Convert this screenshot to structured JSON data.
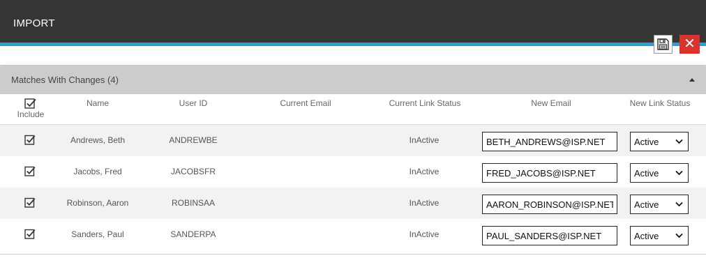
{
  "header": {
    "title": "IMPORT"
  },
  "toolbar": {
    "save_icon": "save-icon",
    "close_icon": "close-icon",
    "close_glyph": "✕"
  },
  "section": {
    "title": "Matches With Changes (4)"
  },
  "columns": {
    "include": "Include",
    "name": "Name",
    "user_id": "User ID",
    "current_email": "Current Email",
    "current_link_status": "Current Link Status",
    "new_email": "New Email",
    "new_link_status": "New Link Status"
  },
  "rows": [
    {
      "include": true,
      "name": "Andrews, Beth",
      "user_id": "ANDREWBE",
      "current_email": "",
      "current_link_status": "InActive",
      "new_email": "BETH_ANDREWS@ISP.NET",
      "new_link_status": "Active"
    },
    {
      "include": true,
      "name": "Jacobs, Fred",
      "user_id": "JACOBSFR",
      "current_email": "",
      "current_link_status": "InActive",
      "new_email": "FRED_JACOBS@ISP.NET",
      "new_link_status": "Active"
    },
    {
      "include": true,
      "name": "Robinson, Aaron",
      "user_id": "ROBINSAA",
      "current_email": "",
      "current_link_status": "InActive",
      "new_email": "AARON_ROBINSON@ISP.NET",
      "new_link_status": "Active"
    },
    {
      "include": true,
      "name": "Sanders, Paul",
      "user_id": "SANDERPA",
      "current_email": "",
      "current_link_status": "InActive",
      "new_email": "PAUL_SANDERS@ISP.NET",
      "new_link_status": "Active"
    }
  ],
  "colors": {
    "header_bg": "#353535",
    "accent": "#2a9fd8",
    "close_bg": "#d9342b",
    "section_bg": "#cccccc",
    "alt_row": "#f2f2f2"
  }
}
